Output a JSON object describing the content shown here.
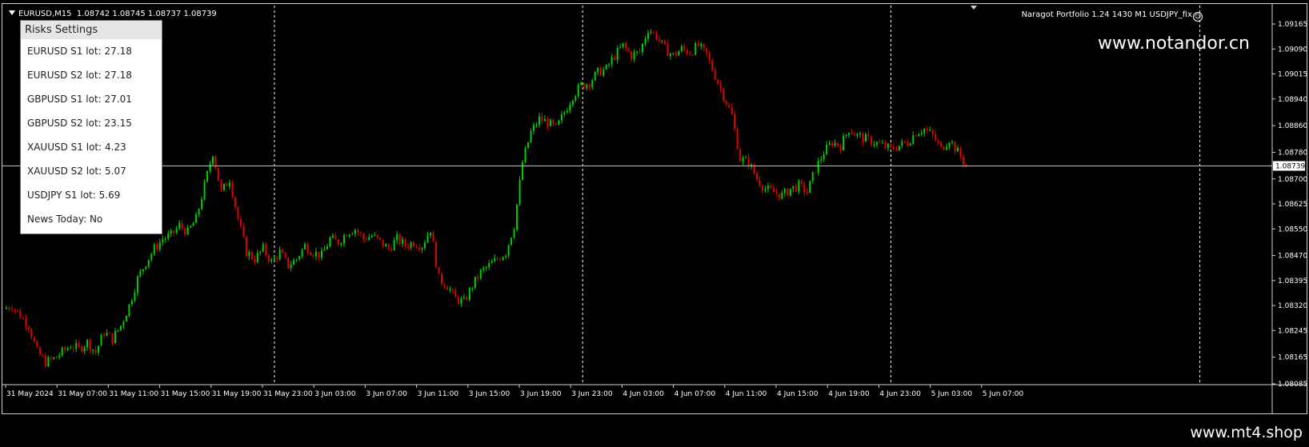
{
  "header": {
    "symbol": "EURUSD,M15",
    "quote": "1.08742 1.08745 1.08737 1.08739"
  },
  "ea_info": {
    "text": "Naragot Portfolio 1.24 1430 M1 USDJPY_fix",
    "icon": "smiley-icon"
  },
  "watermarks": {
    "top": "www.notandor.cn",
    "bottom": "www.mt4.shop"
  },
  "risk_panel": {
    "title": "Risks Settings",
    "rows": [
      {
        "label": "EURUSD S1 lot:",
        "value": "27.18"
      },
      {
        "label": "EURUSD S2 lot:",
        "value": "27.18"
      },
      {
        "label": "GBPUSD S1 lot:",
        "value": "27.01"
      },
      {
        "label": "GBPUSD S2 lot:",
        "value": "23.15"
      },
      {
        "label": "XAUUSD S1 lot:",
        "value": "4.23"
      },
      {
        "label": "XAUUSD S2 lot:",
        "value": "5.07"
      },
      {
        "label": "USDJPY S1 lot:",
        "value": "5.69"
      },
      {
        "label": "News Today:",
        "value": "No"
      }
    ]
  },
  "current_price": "1.08739",
  "colors": {
    "bull": "#00d000",
    "bear": "#e00000",
    "grid": "#ffffff",
    "axis_text": "#ffffff"
  },
  "chart_data": {
    "type": "candlestick",
    "y_ticks": [
      "1.09165",
      "1.09090",
      "1.09015",
      "1.08940",
      "1.08860",
      "1.08780",
      "1.08700",
      "1.08625",
      "1.08550",
      "1.08470",
      "1.08395",
      "1.08320",
      "1.08245",
      "1.08165",
      "1.08085"
    ],
    "ylim": [
      1.08085,
      1.09165
    ],
    "x_ticks": [
      "31 May 2024",
      "31 May 07:00",
      "31 May 11:00",
      "31 May 15:00",
      "31 May 19:00",
      "31 May 23:00",
      "3 Jun 03:00",
      "3 Jun 07:00",
      "3 Jun 11:00",
      "3 Jun 15:00",
      "3 Jun 19:00",
      "3 Jun 23:00",
      "4 Jun 03:00",
      "4 Jun 07:00",
      "4 Jun 11:00",
      "4 Jun 15:00",
      "4 Jun 19:00",
      "4 Jun 23:00",
      "5 Jun 03:00",
      "5 Jun 07:00"
    ],
    "day_separators": [
      "31 May 23:00",
      "3 Jun 23:00",
      "4 Jun 23:00"
    ],
    "current_price": 1.08739,
    "close_path": [
      1.0831,
      1.0832,
      1.0829,
      1.0826,
      1.0818,
      1.0815,
      1.0816,
      1.0818,
      1.082,
      1.0819,
      1.0821,
      1.0818,
      1.0824,
      1.0822,
      1.0826,
      1.0832,
      1.084,
      1.0845,
      1.0849,
      1.0852,
      1.0853,
      1.0856,
      1.0854,
      1.0858,
      1.0868,
      1.0878,
      1.0866,
      1.087,
      1.0858,
      1.0848,
      1.0846,
      1.0849,
      1.0845,
      1.0848,
      1.0844,
      1.0846,
      1.085,
      1.0848,
      1.0847,
      1.0852,
      1.0851,
      1.0854,
      1.0855,
      1.0852,
      1.0853,
      1.0851,
      1.0849,
      1.0852,
      1.085,
      1.0851,
      1.085,
      1.0855,
      1.084,
      1.0838,
      1.0834,
      1.0833,
      1.0838,
      1.0842,
      1.0844,
      1.0846,
      1.0848,
      1.0856,
      1.0875,
      1.0884,
      1.0888,
      1.0887,
      1.0885,
      1.089,
      1.0895,
      1.0898,
      1.0899,
      1.0902,
      1.0903,
      1.0907,
      1.091,
      1.0907,
      1.0908,
      1.0915,
      1.0913,
      1.0909,
      1.0907,
      1.0909,
      1.0908,
      1.091,
      1.0907,
      1.0901,
      1.0895,
      1.0889,
      1.0876,
      1.0875,
      1.087,
      1.0867,
      1.0866,
      1.0865,
      1.0867,
      1.0868,
      1.0866,
      1.0873,
      1.0878,
      1.0881,
      1.088,
      1.0885,
      1.0883,
      1.0882,
      1.0881,
      1.088,
      1.0879,
      1.088,
      1.0881,
      1.0884,
      1.0885,
      1.0883,
      1.0879,
      1.0882,
      1.0878,
      1.0874
    ]
  }
}
